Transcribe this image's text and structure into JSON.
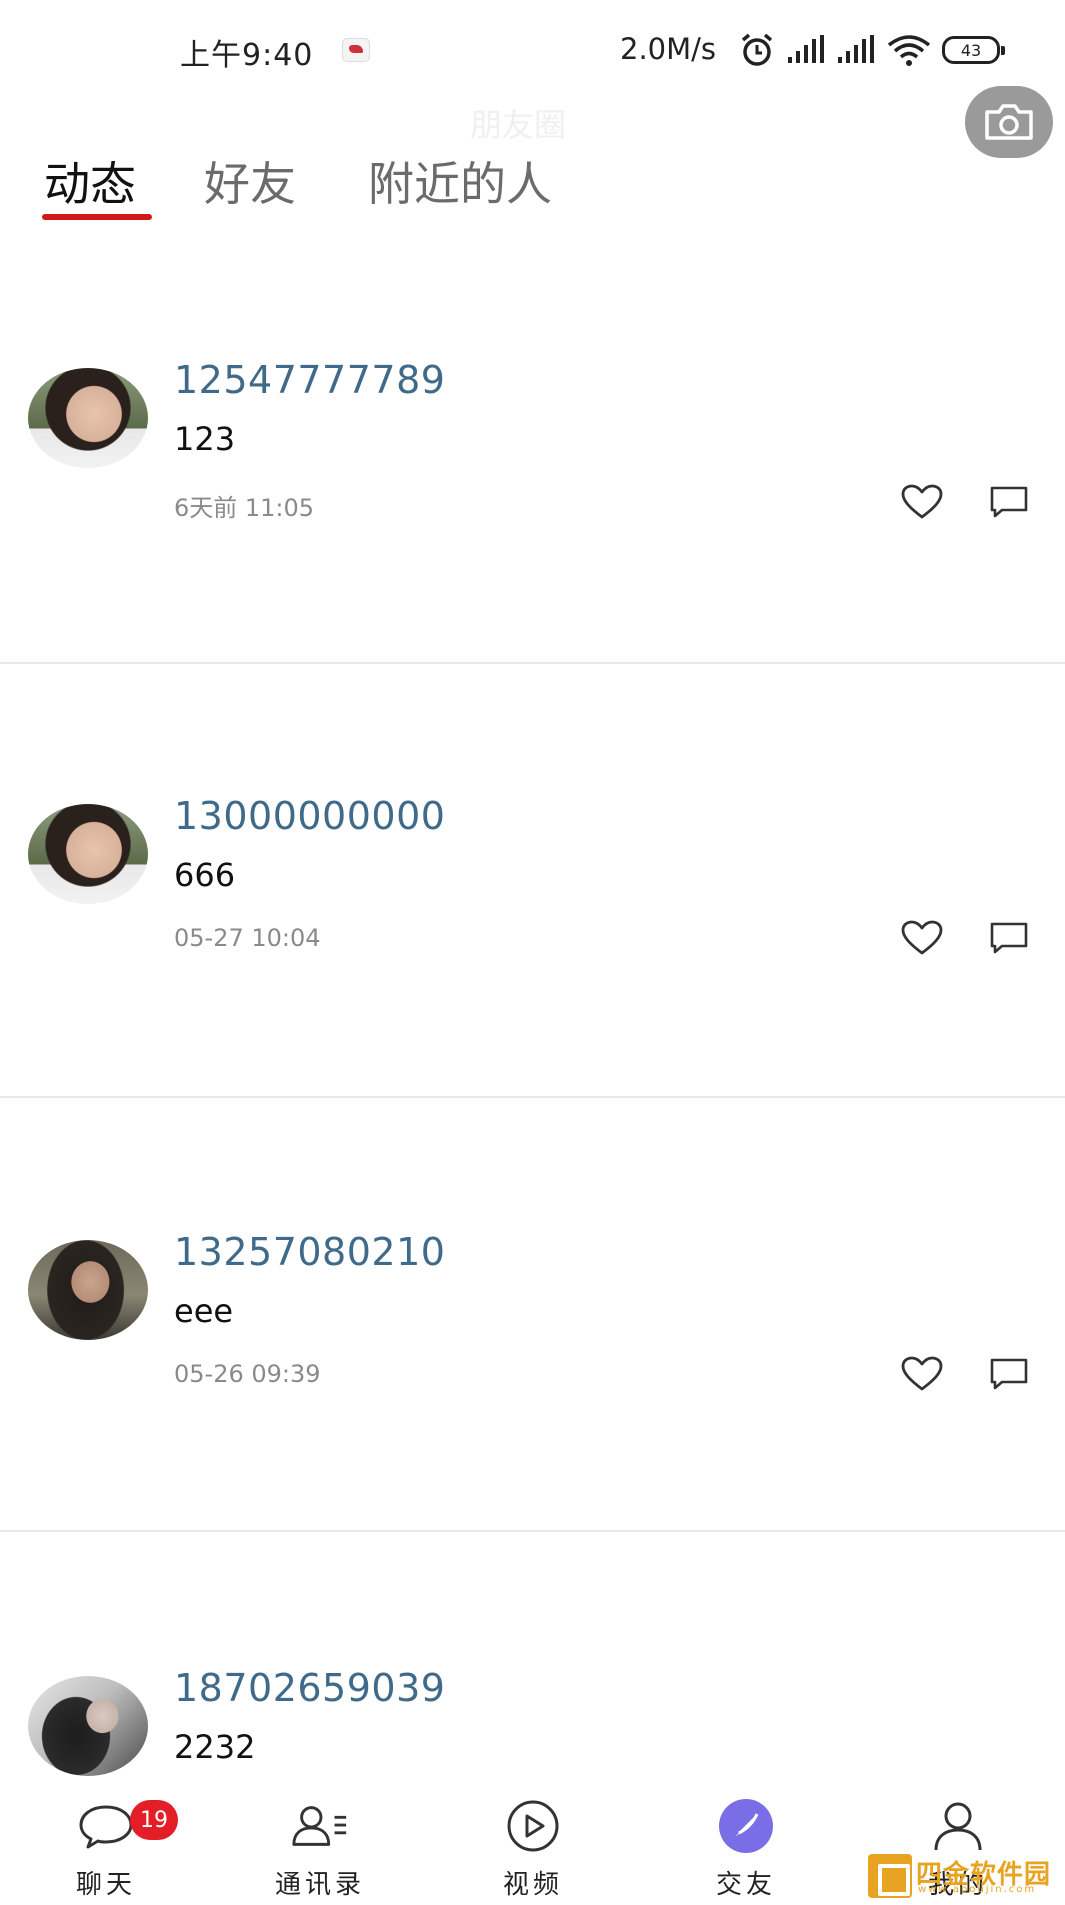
{
  "status_bar": {
    "time": "上午9:40",
    "speed": "2.0M/s",
    "battery": "43"
  },
  "header": {
    "faint_title": "朋友圈",
    "camera_icon": "camera-icon"
  },
  "tabs": [
    {
      "label": "动态",
      "active": true
    },
    {
      "label": "好友",
      "active": false
    },
    {
      "label": "附近的人",
      "active": false
    }
  ],
  "accent_color": "#d21919",
  "posts": [
    {
      "username": "12547777789",
      "content": "123",
      "time": "6天前 11:05"
    },
    {
      "username": "13000000000",
      "content": "666",
      "time": "05-27 10:04"
    },
    {
      "username": "13257080210",
      "content": "eee",
      "time": "05-26 09:39"
    },
    {
      "username": "18702659039",
      "content": "2232"
    }
  ],
  "bottom_nav": [
    {
      "label": "聊天",
      "icon": "chat-icon",
      "badge": "19"
    },
    {
      "label": "通讯录",
      "icon": "contacts-icon"
    },
    {
      "label": "视频",
      "icon": "video-play-icon"
    },
    {
      "label": "交友",
      "icon": "compass-icon",
      "active": true
    },
    {
      "label": "我的",
      "icon": "profile-icon"
    }
  ],
  "watermark": {
    "text": "四金软件园",
    "sub": "www.apoujin.com"
  }
}
